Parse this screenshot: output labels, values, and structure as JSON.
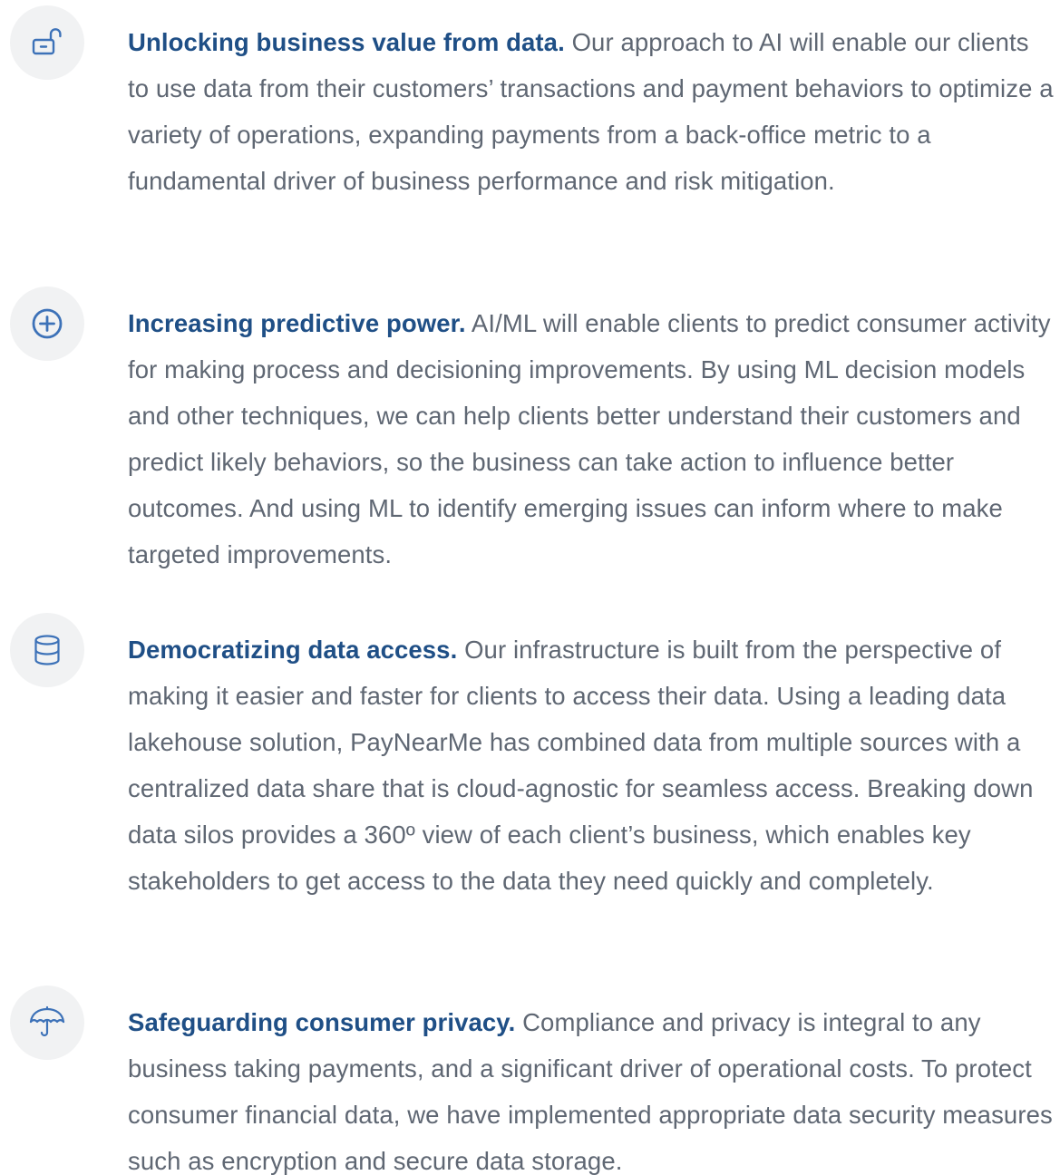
{
  "accent_color": "#1f4f86",
  "body_text_color": "#5f6773",
  "icon_circle_color": "#f1f2f3",
  "icon_color": "#3d72b8",
  "features": [
    {
      "icon": "unlock-icon",
      "title": "Unlocking business value from data.",
      "body": "Our approach to AI will enable our clients to use data from their customers’ transactions and payment behaviors to optimize a variety of operations, expanding payments from a back-office metric to a fundamental driver of business performance and risk mitigation."
    },
    {
      "icon": "plus-circle-icon",
      "title": "Increasing predictive power.",
      "body": "AI/ML will enable clients to predict consumer activity for making process and decisioning improvements. By using ML decision models and other techniques, we can help clients better understand their customers and predict likely behaviors, so the business can take action to influence better outcomes. And using ML to identify emerging issues can inform where to make targeted improvements."
    },
    {
      "icon": "database-icon",
      "title": "Democratizing data access.",
      "body": "Our infrastructure is built from the perspective of making it easier and faster for clients to access their data. Using a leading data lakehouse solution, PayNearMe has combined data from multiple sources with a centralized data share that is cloud-agnostic for seamless access. Breaking down data silos provides a 360º view of each client’s business, which enables key stakeholders to get access to the data they need quickly and completely."
    },
    {
      "icon": "umbrella-icon",
      "title": "Safeguarding consumer privacy.",
      "body": "Compliance and privacy is integral to any business taking payments, and a significant driver of operational costs. To protect consumer financial data, we have implemented appropriate data security measures such as encryption and secure data storage."
    }
  ]
}
